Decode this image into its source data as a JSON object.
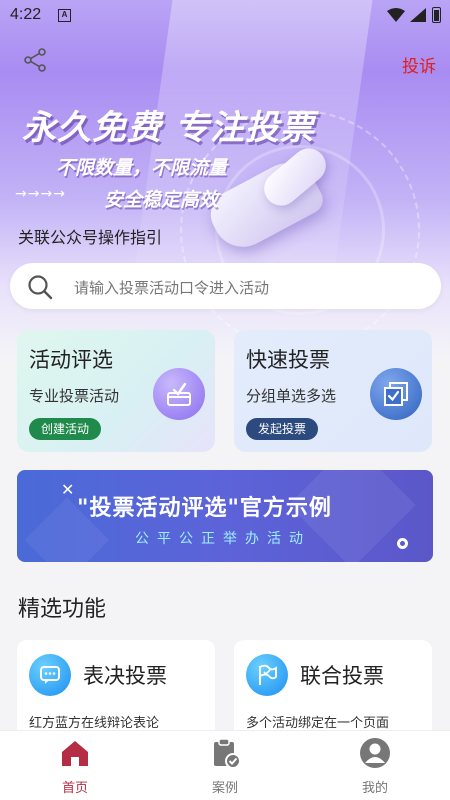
{
  "status_bar": {
    "time": "4:22",
    "sim_label": "A"
  },
  "header": {
    "complain_label": "投诉"
  },
  "banner": {
    "title": "永久免费 专注投票",
    "subtitle_line1": "不限数量，不限流量",
    "subtitle_line2": "安全稳定高效",
    "arrows": "→→→→",
    "guide_link": "关联公众号操作指引"
  },
  "search": {
    "placeholder": "请输入投票活动口令进入活动"
  },
  "cards": [
    {
      "title": "活动评选",
      "desc": "专业投票活动",
      "button": "创建活动",
      "icon": "ballot-box-icon"
    },
    {
      "title": "快速投票",
      "desc": "分组单选多选",
      "button": "发起投票",
      "icon": "stacked-check-icon"
    }
  ],
  "promo": {
    "title": "\"投票活动评选\"官方示例",
    "subtitle": "公平公正举办活动"
  },
  "featured": {
    "section_title": "精选功能",
    "items": [
      {
        "title": "表决投票",
        "desc": "红方蓝方在线辩论表论",
        "icon": "chat-bubble-icon"
      },
      {
        "title": "联合投票",
        "desc": "多个活动绑定在一个页面",
        "icon": "flag-icon"
      }
    ]
  },
  "tabbar": {
    "items": [
      {
        "label": "首页",
        "icon": "home-icon",
        "active": true
      },
      {
        "label": "案例",
        "icon": "clipboard-check-icon",
        "active": false
      },
      {
        "label": "我的",
        "icon": "user-icon",
        "active": false
      }
    ]
  },
  "colors": {
    "accent": "#b42d44",
    "complain": "#e0201a",
    "green_button": "#1f8a4c",
    "blue_button": "#2c4a7e",
    "promo_bg": "#5d63d9"
  }
}
